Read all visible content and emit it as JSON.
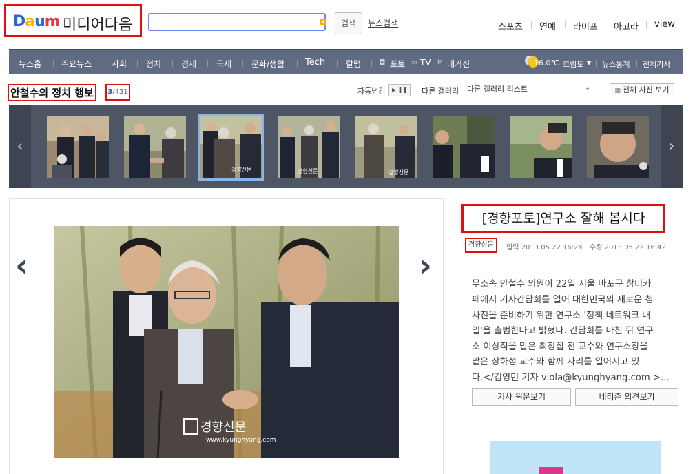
{
  "logo": {
    "brand_letters": [
      "D",
      "a",
      "u",
      "m"
    ],
    "media_text": "미디어다음"
  },
  "search": {
    "button_label": "검색",
    "news_search_label": "뉴스검색"
  },
  "top_nav": [
    "스포츠",
    "연예",
    "라이프",
    "아고라",
    "view"
  ],
  "main_nav": [
    "뉴스홈",
    "주요뉴스",
    "사회",
    "정치",
    "경제",
    "국제",
    "문화/생활",
    "Tech",
    "칼럼",
    "포토",
    "TV",
    "매거진"
  ],
  "nav_right": {
    "temperature": "16.0℃",
    "location": "흐림도",
    "stats": "뉴스통계",
    "all_articles": "전체기사"
  },
  "gallery": {
    "title": "안철수의 정치 행보",
    "current": "3",
    "total": "/431",
    "auto_label": "자동넘김",
    "play_icons": "▶ ❚❚",
    "other_label": "다른 갤러리",
    "select_value": "다른 갤러리 리스트",
    "all_photos_label": "전체 사진 보기",
    "thumbnail_count": 8,
    "active_index": 2
  },
  "article": {
    "headline": "[경향포토]연구소 잘해 봅시다",
    "source": "경향신문",
    "input_time": "입력 2013.05.22 16:24",
    "edit_time": "수정 2013.05.22 16:42",
    "body_lines": [
      "무소속 안철수 의원이 22일 서울 마포구 창비카",
      "페에서 기자간담회를 열어 대한민국의 새로운 청",
      "사진을 준비하기 위한 연구소 '정책 네트워크 내",
      "일'을 출범한다고 밝혔다. 간담회를 마친 뒤 연구",
      "소 이상직을 맡은 최장집 전 교수와 연구소장을",
      "맡은 장하성 교수와 함께 자리를 일어서고 있",
      "다.</김영민 기자 viola@kyunghyang.com >..."
    ],
    "original_button": "기사 원문보기",
    "comments_button": "네티즌 의견보기"
  },
  "photo_watermark": {
    "brand": "경향신문",
    "url": "www.kyunghyang.com"
  },
  "colors": {
    "nav_bg": "#606a80",
    "strip_bg": "#4e5565",
    "highlight": "#e01010",
    "accent_blue": "#2d64d8"
  }
}
